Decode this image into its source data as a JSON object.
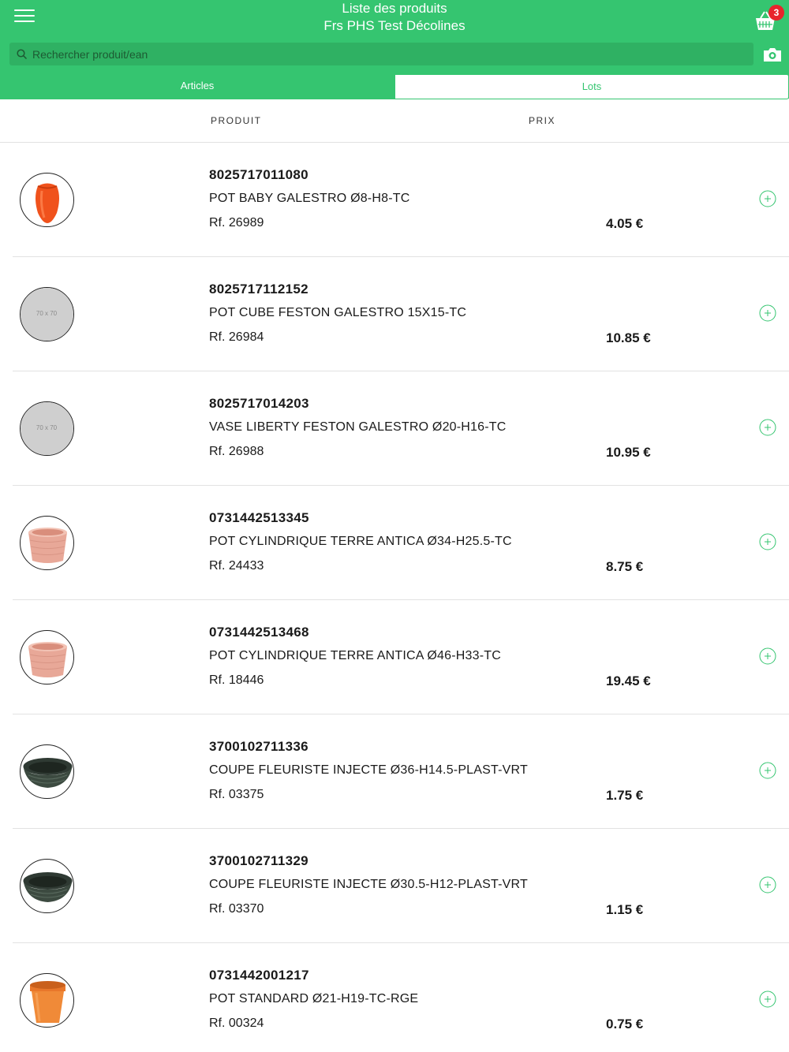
{
  "header": {
    "title_line1": "Liste des produits",
    "title_line2": "Frs PHS Test Décolines",
    "cart_count": "3",
    "brand_color": "#35c570"
  },
  "search": {
    "placeholder": "Rechercher produit/ean"
  },
  "tabs": [
    {
      "label": "Articles",
      "active": true
    },
    {
      "label": "Lots",
      "active": false
    }
  ],
  "columns": {
    "product": "PRODUIT",
    "price": "PRIX"
  },
  "products": [
    {
      "ean": "8025717011080",
      "name": "POT BABY GALESTRO Ø8-H8-TC",
      "ref": "Rf. 26989",
      "price": "4.05 €",
      "image": "orange-vase"
    },
    {
      "ean": "8025717112152",
      "name": "POT CUBE FESTON GALESTRO 15X15-TC",
      "ref": "Rf. 26984",
      "price": "10.85 €",
      "image": "placeholder",
      "image_text": "70 x 70"
    },
    {
      "ean": "8025717014203",
      "name": "VASE LIBERTY FESTON GALESTRO Ø20-H16-TC",
      "ref": "Rf. 26988",
      "price": "10.95 €",
      "image": "placeholder",
      "image_text": "70 x 70"
    },
    {
      "ean": "0731442513345",
      "name": "POT CYLINDRIQUE TERRE ANTICA Ø34-H25.5-TC",
      "ref": "Rf. 24433",
      "price": "8.75 €",
      "image": "pink-pot"
    },
    {
      "ean": "0731442513468",
      "name": "POT CYLINDRIQUE TERRE ANTICA Ø46-H33-TC",
      "ref": "Rf. 18446",
      "price": "19.45 €",
      "image": "pink-pot"
    },
    {
      "ean": "3700102711336",
      "name": "COUPE FLEURISTE INJECTE Ø36-H14.5-PLAST-VRT",
      "ref": "Rf. 03375",
      "price": "1.75 €",
      "image": "green-bowl"
    },
    {
      "ean": "3700102711329",
      "name": "COUPE FLEURISTE INJECTE Ø30.5-H12-PLAST-VRT",
      "ref": "Rf. 03370",
      "price": "1.15 €",
      "image": "green-bowl"
    },
    {
      "ean": "0731442001217",
      "name": "POT STANDARD Ø21-H19-TC-RGE",
      "ref": "Rf. 00324",
      "price": "0.75 €",
      "image": "terracotta-pot"
    }
  ]
}
